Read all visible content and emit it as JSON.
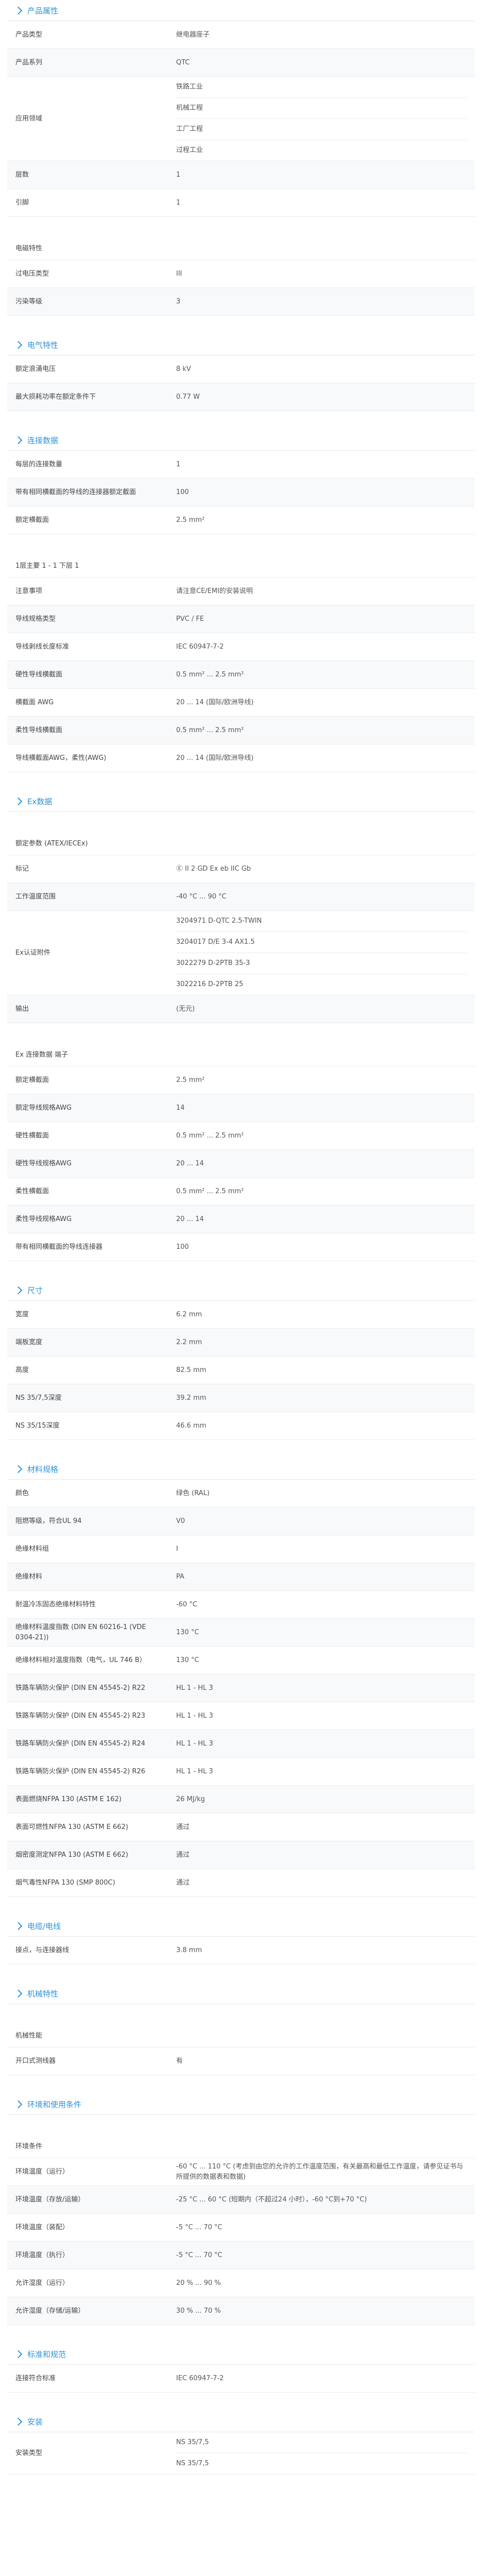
{
  "sections": [
    {
      "title": "产品属性",
      "rows": [
        {
          "k": "产品类型",
          "v": [
            "继电器座子"
          ]
        },
        {
          "k": "产品系列",
          "v": [
            "QTC"
          ]
        },
        {
          "k": "应用领域",
          "v": [
            "铁路工业",
            "机械工程",
            "工厂工程",
            "过程工业"
          ]
        },
        {
          "k": "层数",
          "v": [
            "1"
          ]
        },
        {
          "k": "引脚",
          "v": [
            "1"
          ]
        }
      ]
    },
    {
      "title": "",
      "sub": "电磁特性",
      "rows": [
        {
          "k": "过电压类型",
          "v": [
            "III"
          ]
        },
        {
          "k": "污染等级",
          "v": [
            "3"
          ]
        }
      ]
    },
    {
      "title": "电气特性",
      "rows": [
        {
          "k": "额定浪涌电压",
          "v": [
            "8 kV"
          ]
        },
        {
          "k": "最大损耗功率在额定条件下",
          "v": [
            "0.77 W"
          ]
        }
      ]
    },
    {
      "title": "连接数据",
      "rows": [
        {
          "k": "每层的连接数量",
          "v": [
            "1"
          ]
        },
        {
          "k": "带有相同横截面的导线的连接器额定截面",
          "v": [
            "100"
          ]
        },
        {
          "k": "额定横截面",
          "v": [
            "2.5 mm²"
          ]
        }
      ]
    },
    {
      "title": "",
      "sub": "1层主要 1 - 1 下层 1",
      "rows": [
        {
          "k": "注意事项",
          "v": [
            "请注意CE/EMI的安装说明"
          ]
        },
        {
          "k": "导线规格类型",
          "v": [
            "PVC / FE"
          ]
        },
        {
          "k": "导线剥线长度标准",
          "v": [
            "IEC 60947-7-2"
          ]
        },
        {
          "k": "硬性导线横截面",
          "v": [
            "0.5 mm² ... 2.5 mm²"
          ]
        },
        {
          "k": "横截面 AWG",
          "v": [
            "20 ... 14 (国际/欧洲导线)"
          ]
        },
        {
          "k": "柔性导线横截面",
          "v": [
            "0.5 mm² ... 2.5 mm²"
          ]
        },
        {
          "k": "导线横截面AWG，柔性(AWG)",
          "v": [
            "20 ... 14 (国际/欧洲导线)"
          ]
        }
      ]
    },
    {
      "title": "Ex数据",
      "rows": []
    },
    {
      "title": "",
      "sub": "额定参数 (ATEX/IECEx)",
      "rows": [
        {
          "k": "标记",
          "v": [
            "Ⓔ II 2 GD Ex eb IIC Gb"
          ]
        },
        {
          "k": "工作温度范围",
          "v": [
            "-40 °C ... 90 °C"
          ]
        },
        {
          "k": "Ex认证附件",
          "v": [
            "3204971 D-QTC 2.5-TWIN",
            "3204017 D/E 3-4 AX1.5",
            "3022279 D-2PTB 35-3",
            "3022216 D-2PTB 25"
          ]
        },
        {
          "k": "输出",
          "v": [
            "(无元)"
          ]
        }
      ]
    },
    {
      "title": "",
      "sub": "Ex 连接数据 端子",
      "rows": [
        {
          "k": "额定横截面",
          "v": [
            "2.5 mm²"
          ]
        },
        {
          "k": "额定导线规格AWG",
          "v": [
            "14"
          ]
        },
        {
          "k": "硬性横截面",
          "v": [
            "0.5 mm² ... 2.5 mm²"
          ]
        },
        {
          "k": "硬性导线规格AWG",
          "v": [
            "20 ... 14"
          ]
        },
        {
          "k": "柔性横截面",
          "v": [
            "0.5 mm² ... 2.5 mm²"
          ]
        },
        {
          "k": "柔性导线规格AWG",
          "v": [
            "20 ... 14"
          ]
        },
        {
          "k": "带有相同横截面的导线连接器",
          "v": [
            "100"
          ]
        }
      ]
    },
    {
      "title": "尺寸",
      "rows": [
        {
          "k": "宽度",
          "v": [
            "6.2 mm"
          ]
        },
        {
          "k": "端板宽度",
          "v": [
            "2.2 mm"
          ]
        },
        {
          "k": "高度",
          "v": [
            "82.5 mm"
          ]
        },
        {
          "k": "NS 35/7,5深度",
          "v": [
            "39.2 mm"
          ]
        },
        {
          "k": "NS 35/15深度",
          "v": [
            "46.6 mm"
          ]
        }
      ]
    },
    {
      "title": "材料规格",
      "rows": [
        {
          "k": "颜色",
          "v": [
            "绿色 (RAL)"
          ]
        },
        {
          "k": "阻燃等级，符合UL 94",
          "v": [
            "V0"
          ]
        },
        {
          "k": "绝缘材料组",
          "v": [
            "I"
          ]
        },
        {
          "k": "绝缘材料",
          "v": [
            "PA"
          ]
        },
        {
          "k": "耐温冷冻固态绝缘材料特性",
          "v": [
            "-60 °C"
          ]
        },
        {
          "k": "绝缘材料温度指数 (DIN EN 60216-1 (VDE 0304-21))",
          "v": [
            "130 °C"
          ]
        },
        {
          "k": "绝缘材料相对温度指数（电气，UL 746 B）",
          "v": [
            "130 °C"
          ]
        },
        {
          "k": "铁路车辆防火保护 (DIN EN 45545-2) R22",
          "v": [
            "HL 1 - HL 3"
          ]
        },
        {
          "k": "铁路车辆防火保护 (DIN EN 45545-2) R23",
          "v": [
            "HL 1 - HL 3"
          ]
        },
        {
          "k": "铁路车辆防火保护 (DIN EN 45545-2) R24",
          "v": [
            "HL 1 - HL 3"
          ]
        },
        {
          "k": "铁路车辆防火保护 (DIN EN 45545-2) R26",
          "v": [
            "HL 1 - HL 3"
          ]
        },
        {
          "k": "表面燃烧NFPA 130 (ASTM E 162)",
          "v": [
            "26 MJ/kg"
          ]
        },
        {
          "k": "表面可燃性NFPA 130 (ASTM E 662)",
          "v": [
            "通过"
          ]
        },
        {
          "k": "烟密度测定NFPA 130 (ASTM E 662)",
          "v": [
            "通过"
          ]
        },
        {
          "k": "烟气毒性NFPA 130 (SMP 800C)",
          "v": [
            "通过"
          ]
        }
      ]
    },
    {
      "title": "电缆/电线",
      "rows": [
        {
          "k": "接点，与连接器线",
          "v": [
            "3.8 mm"
          ]
        }
      ]
    },
    {
      "title": "机械特性",
      "rows": []
    },
    {
      "title": "",
      "sub": "机械性能",
      "rows": [
        {
          "k": "开口式测线器",
          "v": [
            "有"
          ]
        }
      ]
    },
    {
      "title": "环境和使用条件",
      "rows": []
    },
    {
      "title": "",
      "sub": "环境条件",
      "rows": [
        {
          "k": "环境温度（运行）",
          "v": [
            "-60 °C ... 110 °C (考虑到由您的允许的工作温度范围，有关最高和最低工作温度，请参见证书与所提供的数据表和数据)"
          ]
        },
        {
          "k": "环境温度（存放/运输）",
          "v": [
            "-25 °C ... 60 °C (短期内（不超过24 小时），-60 °C到+70 °C)"
          ]
        },
        {
          "k": "环境温度（装配）",
          "v": [
            "-5 °C ... 70 °C"
          ]
        },
        {
          "k": "环境温度（执行）",
          "v": [
            "-5 °C ... 70 °C"
          ]
        },
        {
          "k": "允许湿度（运行）",
          "v": [
            "20 % ... 90 %"
          ]
        },
        {
          "k": "允许湿度（存储/运输）",
          "v": [
            "30 % ... 70 %"
          ]
        }
      ]
    },
    {
      "title": "标准和规范",
      "rows": [
        {
          "k": "连接符合标准",
          "v": [
            "IEC 60947-7-2"
          ]
        }
      ]
    },
    {
      "title": "安装",
      "rows": [
        {
          "k": "安装类型",
          "v": [
            "NS 35/7,5",
            "NS 35/7,5"
          ]
        }
      ]
    }
  ]
}
